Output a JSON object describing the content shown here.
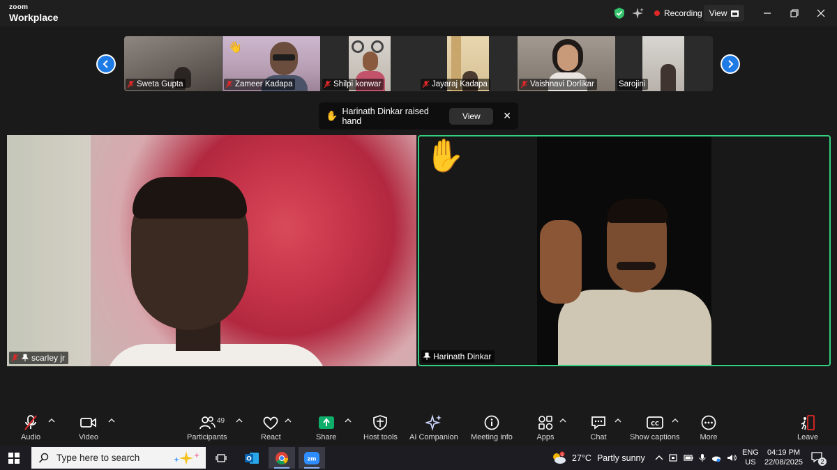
{
  "titlebar": {
    "logo_small": "zoom",
    "logo_big": "Workplace",
    "recording_label": "Recording",
    "view_label": "View"
  },
  "gallery": {
    "thumbnails": [
      {
        "name": "Sweta Gupta",
        "muted": true
      },
      {
        "name": "Zameer Kadapa",
        "muted": true,
        "reaction": "👋"
      },
      {
        "name": "Shilpi konwar",
        "muted": true
      },
      {
        "name": "Jayaraj Kadapa",
        "muted": true
      },
      {
        "name": "Vaishnavi Dorlikar",
        "muted": true
      },
      {
        "name": "Sarojini",
        "muted": false
      }
    ]
  },
  "toast": {
    "hand": "✋",
    "message": "Harinath Dinkar raised hand",
    "view_label": "View",
    "close": "✕"
  },
  "tiles": {
    "left_name": "scarley jr",
    "right_name": "Harinath Dinkar",
    "raised_hand": "✋"
  },
  "toolbar": {
    "audio": "Audio",
    "video": "Video",
    "participants": "Participants",
    "participants_count": "49",
    "react": "React",
    "share": "Share",
    "host_tools": "Host tools",
    "ai_companion": "AI Companion",
    "meeting_info": "Meeting info",
    "apps": "Apps",
    "chat": "Chat",
    "captions": "Show captions",
    "more": "More",
    "leave": "Leave"
  },
  "taskbar": {
    "search_placeholder": "Type here to search",
    "weather_temp": "27°C",
    "weather_desc": "Partly sunny",
    "lang_top": "ENG",
    "lang_bottom": "US",
    "time": "04:19 PM",
    "date": "22/08/2025",
    "notification_count": "2"
  },
  "colors": {
    "active_speaker": "#35d07f",
    "recording_dot": "#e02828",
    "share_green": "#0ead69",
    "leave_red": "#e02828",
    "nav_arrow": "#1e7be6"
  }
}
